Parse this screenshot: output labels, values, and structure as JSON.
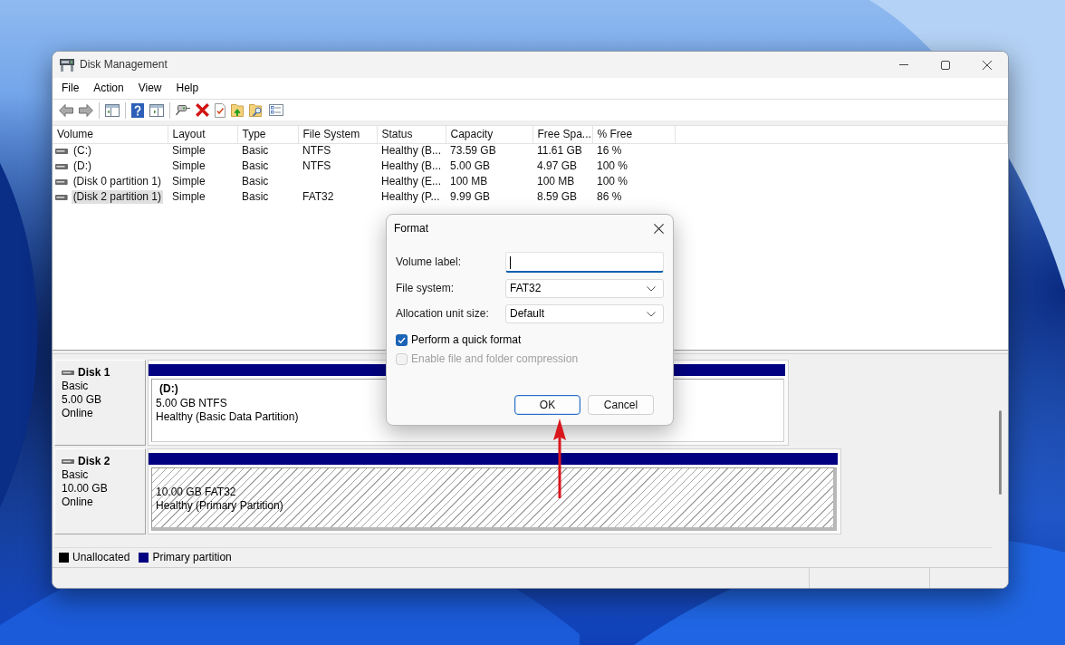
{
  "window": {
    "title": "Disk Management"
  },
  "menu": [
    {
      "label": "File"
    },
    {
      "label": "Action"
    },
    {
      "label": "View"
    },
    {
      "label": "Help"
    }
  ],
  "volume_table": {
    "columns": [
      "Volume",
      "Layout",
      "Type",
      "File System",
      "Status",
      "Capacity",
      "Free Spa...",
      "% Free"
    ],
    "rows": [
      {
        "volume": "(C:)",
        "layout": "Simple",
        "type": "Basic",
        "file_system": "NTFS",
        "status": "Healthy (B...",
        "capacity": "73.59 GB",
        "free_space": "11.61 GB",
        "percent_free": "16 %",
        "selected": false
      },
      {
        "volume": "(D:)",
        "layout": "Simple",
        "type": "Basic",
        "file_system": "NTFS",
        "status": "Healthy (B...",
        "capacity": "5.00 GB",
        "free_space": "4.97 GB",
        "percent_free": "100 %",
        "selected": false
      },
      {
        "volume": "(Disk 0 partition 1)",
        "layout": "Simple",
        "type": "Basic",
        "status": "Healthy (E...",
        "capacity": "100 MB",
        "free_space": "100 MB",
        "percent_free": "100 %",
        "selected": false
      },
      {
        "volume": "(Disk 2 partition 1)",
        "layout": "Simple",
        "type": "Basic",
        "file_system": "FAT32",
        "status": "Healthy (P...",
        "capacity": "9.99 GB",
        "free_space": "8.59 GB",
        "percent_free": "86 %",
        "selected": true
      }
    ]
  },
  "disks": [
    {
      "name": "Disk 1",
      "type": "Basic",
      "size": "5.00 GB",
      "state": "Online",
      "partitions": [
        {
          "label": "(D:)",
          "size": "5.00 GB NTFS",
          "status": "Healthy (Basic Data Partition)",
          "selected": false
        }
      ]
    },
    {
      "name": "Disk 2",
      "type": "Basic",
      "size": "10.00 GB",
      "state": "Online",
      "partitions": [
        {
          "size": "10.00 GB FAT32",
          "status": "Healthy (Primary Partition)",
          "selected": true
        }
      ]
    }
  ],
  "legend": [
    {
      "label": "Unallocated",
      "color": "#000000"
    },
    {
      "label": "Primary partition",
      "color": "#000080"
    }
  ],
  "dialog": {
    "title": "Format",
    "fields": [
      {
        "kind": "text",
        "label": "Volume label:",
        "focused": true
      },
      {
        "kind": "select",
        "label": "File system:",
        "value": "FAT32",
        "focused": false
      },
      {
        "kind": "select",
        "label": "Allocation unit size:",
        "value": "Default",
        "focused": false
      }
    ],
    "options": [
      {
        "label": "Perform a quick format",
        "checked": true,
        "disabled": false
      },
      {
        "label": "Enable file and folder compression",
        "checked": false,
        "disabled": true
      }
    ],
    "buttons": [
      {
        "label": "OK",
        "default": true
      },
      {
        "label": "Cancel",
        "default": false
      }
    ]
  }
}
